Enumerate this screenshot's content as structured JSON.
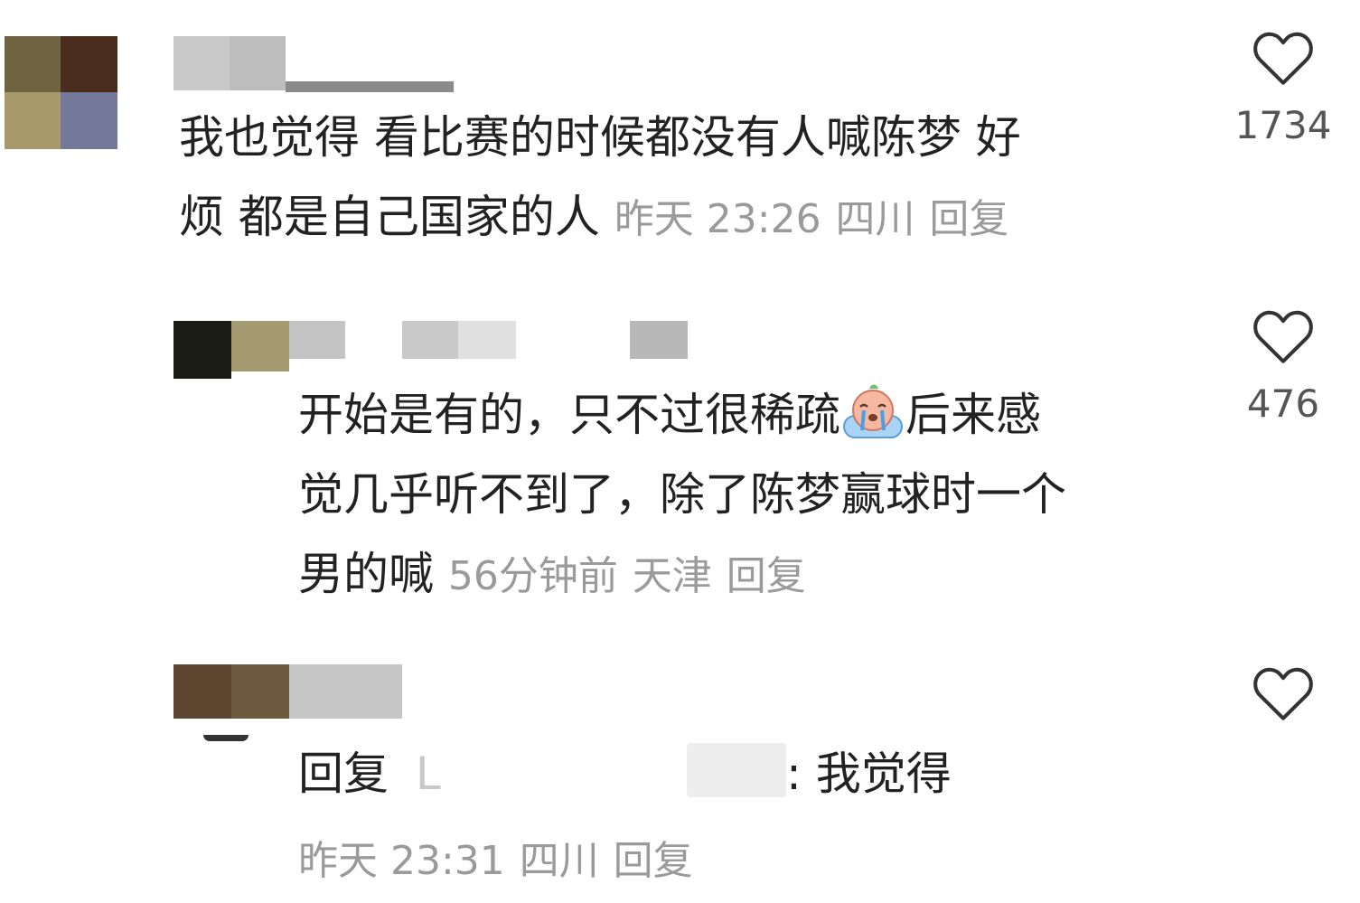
{
  "comments": [
    {
      "line1": "我也觉得 看比赛的时候都没有人喊陈梦 好",
      "line2": "烦 都是自己国家的人",
      "time": "昨天 23:26",
      "location": "四川",
      "reply_label": "回复",
      "likes": "1734"
    },
    {
      "line1a": "开始是有的，只不过很稀疏",
      "line1b": "后来感",
      "line2": "觉几乎听不到了，除了陈梦赢球时一个",
      "line3": "男的喊",
      "time": "56分钟前",
      "location": "天津",
      "reply_label": "回复",
      "likes": "476",
      "emoji": "crying-face-icon"
    },
    {
      "reply_prefix": "回复",
      "reply_target_initial": "L",
      "text": ": 我觉得",
      "time": "昨天 23:31",
      "location": "四川",
      "reply_label": "回复"
    }
  ]
}
